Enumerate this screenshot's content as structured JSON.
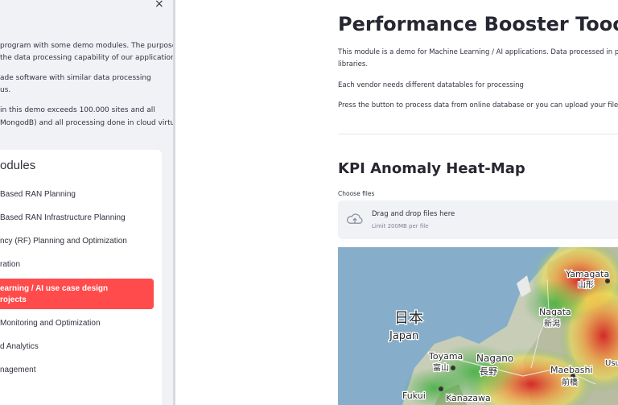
{
  "sidebar": {
    "intro_lines": [
      "program with some demo modules. The purpose",
      "the data processing capability of our applications.",
      "ade software with similar data processing",
      "us.",
      "in this demo exceeds 100.000 sites and all",
      "MongodB) and all processing done in cloud virtual"
    ],
    "menu_title": "odules",
    "menu_items": [
      "Based RAN Planning",
      "Based RAN Infrastructure Planning",
      "ncy (RF) Planning and Optimization",
      "ration",
      "Monitoring and Optimization",
      "d Analytics",
      "nagement"
    ],
    "active_item_lines": [
      "earning / AI use case design",
      "rojects"
    ],
    "close_symbol": "×"
  },
  "main": {
    "title": "Performance Booster Toools",
    "paragraph1_line1": "This module is a demo for Machine Learning / AI applications. Data processed in pythor",
    "paragraph1_line2": "libraries.",
    "paragraph2": "Each vendor needs different datatables for processing",
    "paragraph3": "Press the button to process data from online database or you can upload your files if yo",
    "section_title": "KPI Anomaly Heat-Map",
    "uploader": {
      "label": "Choose files",
      "main_text": "Drag and drop files here",
      "limit_text": "Limit 200MB per file"
    },
    "map_labels": {
      "japan_kanji": "日本",
      "japan": "Japan",
      "yamagata": "Yamagata",
      "yamagata_kanji": "山形",
      "nagata": "Nagata",
      "nagata_kanji": "新潟",
      "toyama": "Toyama",
      "toyama_kanji": "富山",
      "nagano": "Nagano",
      "nagano_kanji": "長野",
      "maebashi": "Maebashi",
      "maebashi_kanji": "前橋",
      "fukui": "Fukui",
      "kanazawa": "Kanazawa",
      "usu": "Usu"
    }
  },
  "colors": {
    "accent": "#ff4b4b",
    "sidebar_bg": "#f0f2f6",
    "text": "#31333f"
  }
}
